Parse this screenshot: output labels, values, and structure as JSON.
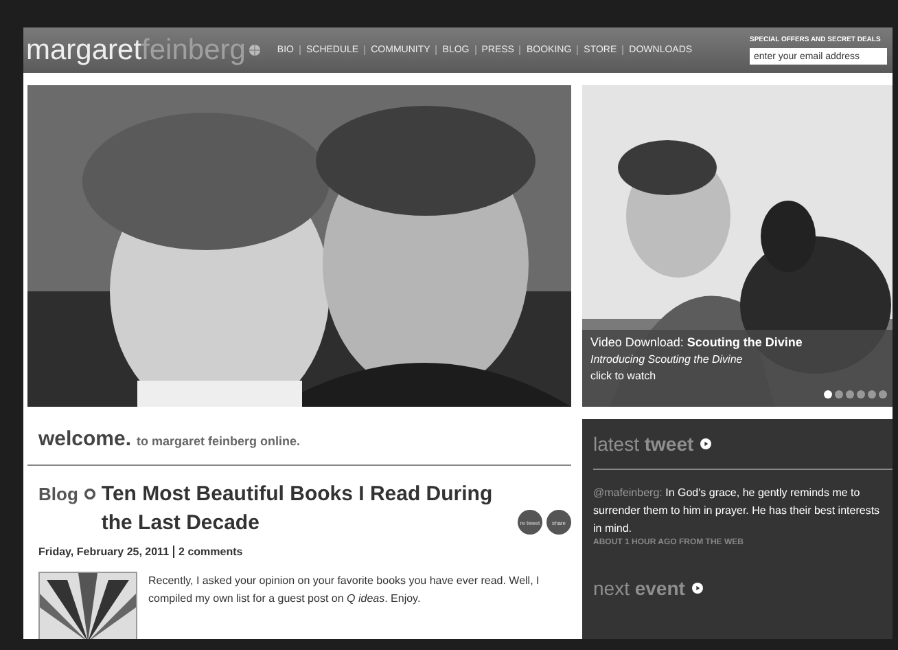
{
  "logo": {
    "first": "margaret",
    "last": "feinberg"
  },
  "nav": [
    "BIO",
    "SCHEDULE",
    "COMMUNITY",
    "BLOG",
    "PRESS",
    "BOOKING",
    "STORE",
    "DOWNLOADS"
  ],
  "signup": {
    "label": "SPECIAL OFFERS AND SECRET DEALS",
    "placeholder": "enter your email address"
  },
  "feature": {
    "title": "Video Download: **Scouting the Divine**",
    "subtitle": "Introducing Scouting the Divine",
    "action": "click to watch",
    "dots": [
      {
        "selected": true
      },
      {
        "selected": false
      },
      {
        "selected": false
      },
      {
        "selected": false
      },
      {
        "selected": false
      },
      {
        "selected": false
      }
    ]
  },
  "welcome": {
    "heading": "welcome.",
    "text": "to margaret feinberg online."
  },
  "blog": {
    "section": "Blog",
    "title": "Ten Most Beautiful Books I Read During the Last Decade",
    "date": "Friday, February 25, 2011",
    "comments": "2 comments",
    "buttons": [
      "re tweet",
      "share"
    ],
    "excerpt": "Recently, I asked your opinion on your favorite books you have ever read. Well, I compiled my own list for a guest post on *Q ideas*. Enjoy."
  },
  "tweet": {
    "heading": "latest **tweet**",
    "handle": "@mafeinberg:",
    "text": "In God's grace, he gently reminds me to surrender them to him in prayer. He has their best interests in mind.",
    "meta": "ABOUT 1 HOUR AGO FROM THE WEB"
  },
  "event": {
    "heading": "next **event**"
  }
}
